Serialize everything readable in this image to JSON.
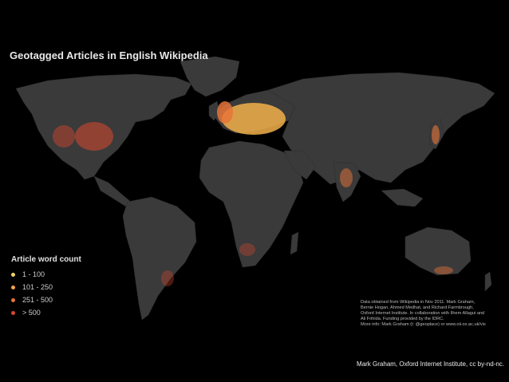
{
  "title": "Geotagged Articles in English Wikipedia",
  "legend": {
    "title": "Article word count",
    "items": [
      {
        "label": "1 - 100",
        "color": "#f2d26b"
      },
      {
        "label": "101 - 250",
        "color": "#f2a54a"
      },
      {
        "label": "251 - 500",
        "color": "#e8743a"
      },
      {
        "label": "> 500",
        "color": "#d9482e"
      }
    ]
  },
  "note": {
    "lines": [
      "Data obtained from Wikipedia in Nov 2011. Mark Graham,",
      "Bernie Hogan, Ahmed Medhat, and Richard Farmbrough,",
      "Oxford Internet Institute. In collaboration with Ilhem Allagui and",
      "Ali Frihida. Funding provided by the IDRC.",
      "More info: Mark Graham (t: @geoplace) or www.oii.ox.ac.uk/vis"
    ]
  },
  "credit": "Mark Graham, Oxford Internet Institute, cc by-nd-nc.",
  "colors": {
    "land": "#3a3a3a",
    "ocean": "#000000"
  }
}
